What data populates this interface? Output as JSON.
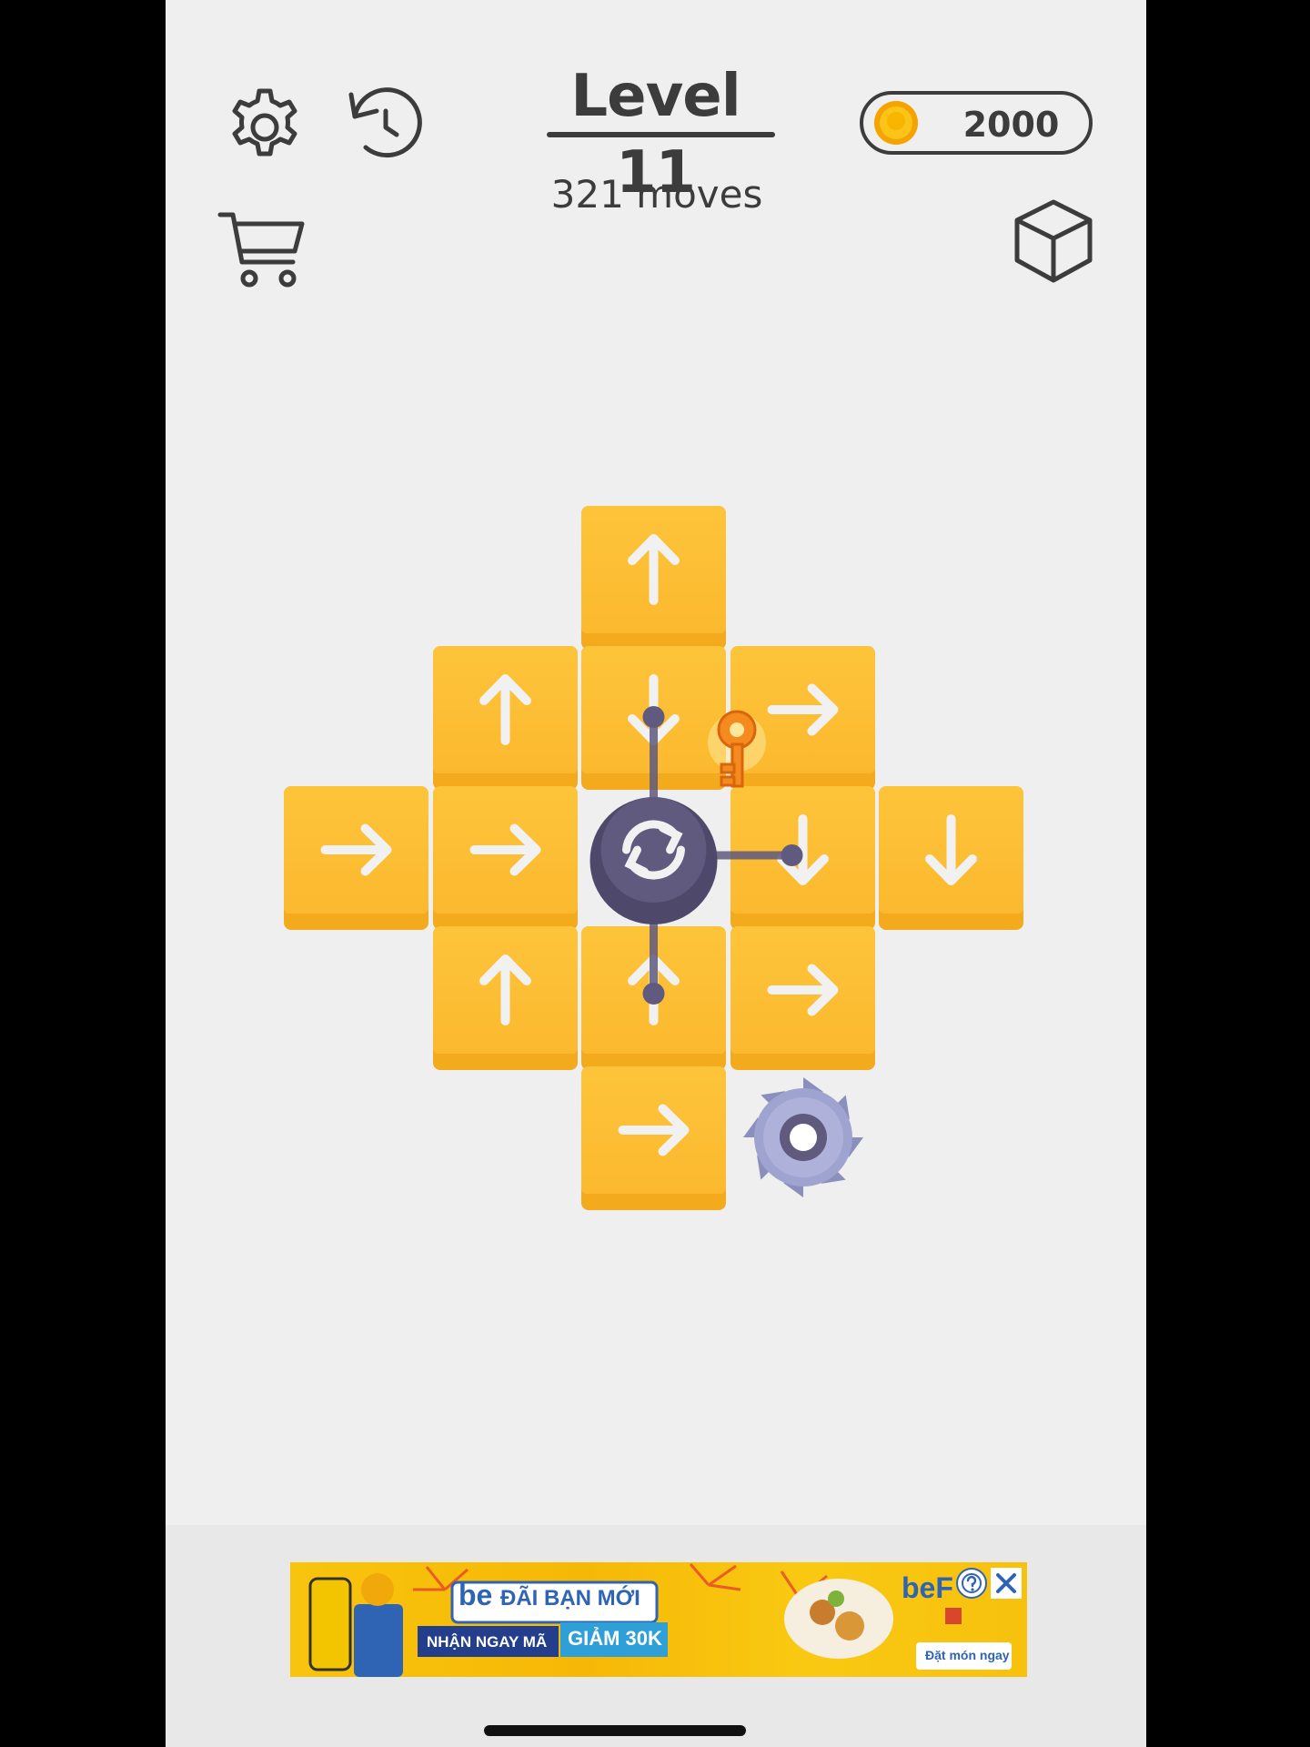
{
  "header": {
    "level_title": "Level 11",
    "moves_text": "321 moves",
    "coins": "2000"
  },
  "icons": [
    "gear-icon",
    "undo-icon",
    "cart-icon",
    "cube-icon",
    "coin-icon",
    "rotate-icon",
    "key-icon",
    "saw-blade-icon"
  ],
  "colors": {
    "background": "#efefef",
    "tile": "#fcbf33",
    "tile_edge": "#f4aa1d",
    "arrow": "#f1f1f1",
    "hub": "#5f5a7e",
    "text": "#3c3c3c"
  },
  "board": {
    "tiles": [
      {
        "row": 0,
        "col": 2,
        "arrow": "up"
      },
      {
        "row": 1,
        "col": 1,
        "arrow": "up"
      },
      {
        "row": 1,
        "col": 2,
        "arrow": "down"
      },
      {
        "row": 1,
        "col": 3,
        "arrow": "right"
      },
      {
        "row": 2,
        "col": 0,
        "arrow": "right"
      },
      {
        "row": 2,
        "col": 1,
        "arrow": "right"
      },
      {
        "row": 2,
        "col": 3,
        "arrow": "down"
      },
      {
        "row": 2,
        "col": 4,
        "arrow": "down"
      },
      {
        "row": 3,
        "col": 1,
        "arrow": "up"
      },
      {
        "row": 3,
        "col": 2,
        "arrow": "up"
      },
      {
        "row": 3,
        "col": 3,
        "arrow": "right"
      },
      {
        "row": 4,
        "col": 2,
        "arrow": "right"
      }
    ],
    "rotator": {
      "row": 2,
      "col": 2,
      "arms": [
        "up",
        "down",
        "right"
      ]
    },
    "key": {
      "near_row": 1,
      "near_col": 3
    },
    "saw": {
      "row": 4,
      "col": 3
    }
  },
  "ad": {
    "brand": "be",
    "headline": "ĐÃI BẠN MỚI",
    "sub_left": "NHẬN NGAY MÃ",
    "sub_right": "GIẢM 30K",
    "brand_right": "beF",
    "cta": "Đặt món ngay"
  }
}
